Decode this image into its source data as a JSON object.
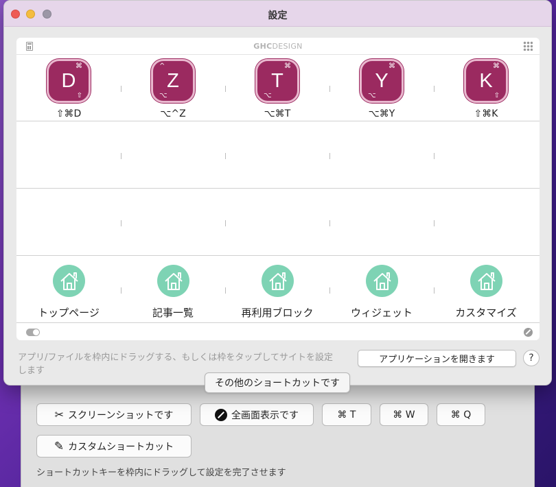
{
  "window": {
    "title": "設定",
    "logo": {
      "bold": "GHC",
      "light": "DESIGN"
    }
  },
  "shortcut_keys": [
    {
      "letter": "D",
      "label": "⇧⌘D",
      "mods": {
        "tr": "⌘",
        "br": "⇧"
      }
    },
    {
      "letter": "Z",
      "label": "⌥^Z",
      "mods": {
        "tl": "^",
        "bl": "⌥"
      }
    },
    {
      "letter": "T",
      "label": "⌥⌘T",
      "mods": {
        "tr": "⌘",
        "bl": "⌥"
      }
    },
    {
      "letter": "Y",
      "label": "⌥⌘Y",
      "mods": {
        "tr": "⌘",
        "bl": "⌥"
      }
    },
    {
      "letter": "K",
      "label": "⇧⌘K",
      "mods": {
        "tr": "⌘",
        "br": "⇧"
      }
    }
  ],
  "site_shortcuts": [
    {
      "label": "トップページ"
    },
    {
      "label": "記事一覧"
    },
    {
      "label": "再利用ブロック"
    },
    {
      "label": "ウィジェット"
    },
    {
      "label": "カスタマイズ"
    }
  ],
  "hint_text": "アプリ/ファイルを枠内にドラッグする、もしくは枠をタップしてサイトを設定します",
  "open_app_button": "アプリケーションを開きます",
  "help_button": "?",
  "other_shortcuts_button": "その他のショートカットです",
  "other_shortcuts": [
    {
      "label": "スクリーンショットです",
      "icon": "scissors-icon"
    },
    {
      "label": "全画面表示です",
      "icon": "no-entry-icon"
    },
    {
      "label": "⌘ T"
    },
    {
      "label": "⌘ W"
    },
    {
      "label": "⌘ Q"
    }
  ],
  "custom_shortcut_button": "カスタムショートカット",
  "sub_hint": "ショートカットキーを枠内にドラッグして設定を完了させます",
  "colors": {
    "key_tile": "#9b2a60",
    "home_icon": "#7ed3b4",
    "titlebar": "#e6d6ea"
  }
}
